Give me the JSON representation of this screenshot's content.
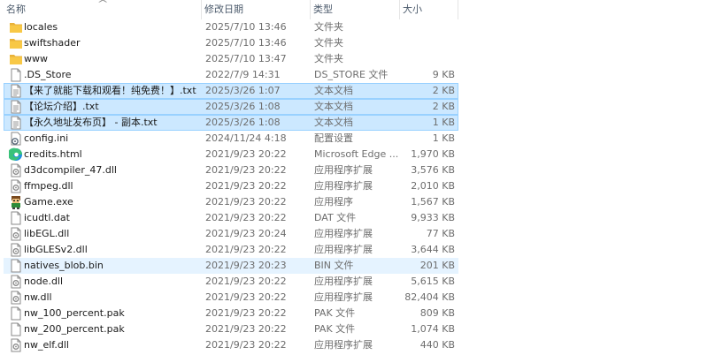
{
  "columns": {
    "name": "名称",
    "date": "修改日期",
    "type": "类型",
    "size": "大小"
  },
  "files": [
    {
      "name": "locales",
      "date": "2025/7/10 13:46",
      "type": "文件夹",
      "size": "",
      "icon": "folder-icon",
      "state": ""
    },
    {
      "name": "swiftshader",
      "date": "2025/7/10 13:46",
      "type": "文件夹",
      "size": "",
      "icon": "folder-icon",
      "state": ""
    },
    {
      "name": "www",
      "date": "2025/7/10 13:47",
      "type": "文件夹",
      "size": "",
      "icon": "folder-icon",
      "state": ""
    },
    {
      "name": ".DS_Store",
      "date": "2022/7/9 14:31",
      "type": "DS_STORE 文件",
      "size": "9 KB",
      "icon": "file-icon",
      "state": ""
    },
    {
      "name": "【来了就能下载和观看！纯免费！】.txt",
      "date": "2025/3/26 1:07",
      "type": "文本文档",
      "size": "2 KB",
      "icon": "text-file-icon",
      "state": "selected"
    },
    {
      "name": "【论坛介绍】.txt",
      "date": "2025/3/26 1:08",
      "type": "文本文档",
      "size": "2 KB",
      "icon": "text-file-icon",
      "state": "selected"
    },
    {
      "name": "【永久地址发布页】 - 副本.txt",
      "date": "2025/3/26 1:08",
      "type": "文本文档",
      "size": "1 KB",
      "icon": "text-file-icon",
      "state": "selected"
    },
    {
      "name": "config.ini",
      "date": "2024/11/24 4:18",
      "type": "配置设置",
      "size": "1 KB",
      "icon": "settings-file-icon",
      "state": ""
    },
    {
      "name": "credits.html",
      "date": "2021/9/23 20:22",
      "type": "Microsoft Edge ...",
      "size": "1,970 KB",
      "icon": "edge-icon",
      "state": ""
    },
    {
      "name": "d3dcompiler_47.dll",
      "date": "2021/9/23 20:22",
      "type": "应用程序扩展",
      "size": "3,576 KB",
      "icon": "dll-icon",
      "state": ""
    },
    {
      "name": "ffmpeg.dll",
      "date": "2021/9/23 20:22",
      "type": "应用程序扩展",
      "size": "2,010 KB",
      "icon": "dll-icon",
      "state": ""
    },
    {
      "name": "Game.exe",
      "date": "2021/9/23 20:22",
      "type": "应用程序",
      "size": "1,567 KB",
      "icon": "game-exe-icon",
      "state": ""
    },
    {
      "name": "icudtl.dat",
      "date": "2021/9/23 20:22",
      "type": "DAT 文件",
      "size": "9,933 KB",
      "icon": "file-icon",
      "state": ""
    },
    {
      "name": "libEGL.dll",
      "date": "2021/9/23 20:24",
      "type": "应用程序扩展",
      "size": "77 KB",
      "icon": "dll-icon",
      "state": ""
    },
    {
      "name": "libGLESv2.dll",
      "date": "2021/9/23 20:22",
      "type": "应用程序扩展",
      "size": "3,644 KB",
      "icon": "dll-icon",
      "state": ""
    },
    {
      "name": "natives_blob.bin",
      "date": "2021/9/23 20:23",
      "type": "BIN 文件",
      "size": "201 KB",
      "icon": "file-icon",
      "state": "hover"
    },
    {
      "name": "node.dll",
      "date": "2021/9/23 20:22",
      "type": "应用程序扩展",
      "size": "5,615 KB",
      "icon": "dll-icon",
      "state": ""
    },
    {
      "name": "nw.dll",
      "date": "2021/9/23 20:22",
      "type": "应用程序扩展",
      "size": "82,404 KB",
      "icon": "dll-icon",
      "state": ""
    },
    {
      "name": "nw_100_percent.pak",
      "date": "2021/9/23 20:22",
      "type": "PAK 文件",
      "size": "809 KB",
      "icon": "file-icon",
      "state": ""
    },
    {
      "name": "nw_200_percent.pak",
      "date": "2021/9/23 20:22",
      "type": "PAK 文件",
      "size": "1,074 KB",
      "icon": "file-icon",
      "state": ""
    },
    {
      "name": "nw_elf.dll",
      "date": "2021/9/23 20:22",
      "type": "应用程序扩展",
      "size": "440 KB",
      "icon": "dll-icon",
      "state": ""
    }
  ],
  "colors": {
    "selected_bg": "#cce8ff",
    "selected_border": "#99d1ff",
    "hover_bg": "#e5f3ff",
    "folder": "#f8c846",
    "header_text": "#4c5b6c",
    "secondary_text": "#6d6d6d"
  }
}
